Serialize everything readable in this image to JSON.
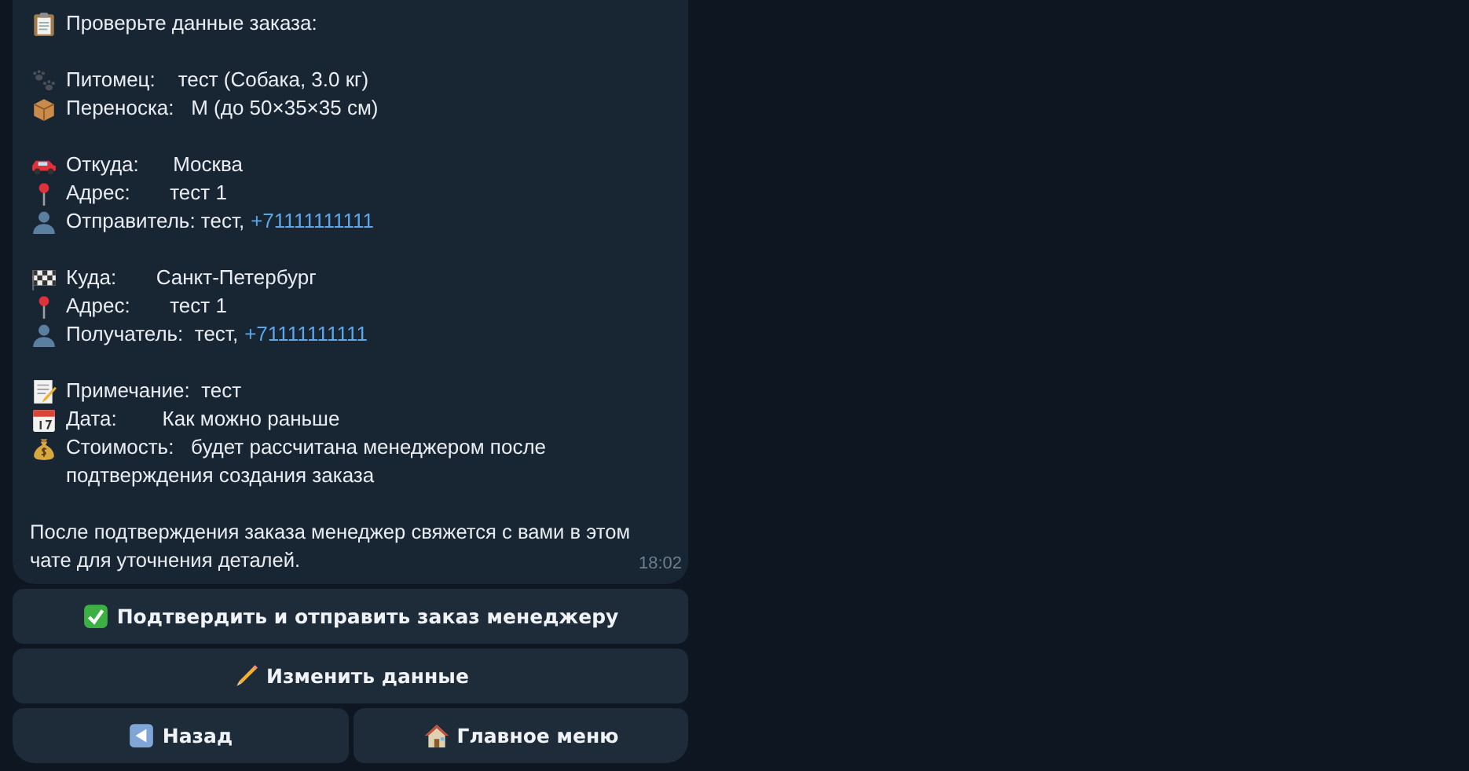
{
  "message": {
    "sections": [
      {
        "lines": [
          {
            "kind": "clipboard",
            "text": "Проверьте данные заказа:"
          }
        ]
      },
      {
        "lines": [
          {
            "kind": "paws",
            "text": "Питомец:    тест (Собака, 3.0 кг)"
          },
          {
            "kind": "box",
            "text": "Переноска:   M (до 50×35×35 см)"
          }
        ]
      },
      {
        "lines": [
          {
            "kind": "car",
            "text": "Откуда:      Москва"
          },
          {
            "kind": "pin",
            "text": "Адрес:       тест 1"
          },
          {
            "kind": "person",
            "text": "Отправитель: тест,",
            "phone": "+71111111111"
          }
        ]
      },
      {
        "lines": [
          {
            "kind": "flag",
            "text": "Куда:       Санкт-Петербург"
          },
          {
            "kind": "pin",
            "text": "Адрес:       тест 1"
          },
          {
            "kind": "person",
            "text": "Получатель:  тест,",
            "phone": "+71111111111"
          }
        ]
      },
      {
        "lines": [
          {
            "kind": "memo",
            "text": "Примечание:  тест"
          },
          {
            "kind": "calendar",
            "text": "Дата:        Как можно раньше"
          },
          {
            "kind": "moneybag",
            "text": "Стоимость:   будет рассчитана менеджером после подтверждения создания заказа"
          }
        ]
      },
      {
        "lines": [
          {
            "text": "После подтверждения заказа менеджер свяжется с вами в этом чате для уточнения деталей."
          }
        ]
      }
    ],
    "time": "18:02"
  },
  "button_rows": [
    [
      {
        "kind": "check",
        "label": "Подтвердить и отправить заказ менеджеру"
      }
    ],
    [
      {
        "kind": "pencil",
        "label": "Изменить данные"
      }
    ],
    [
      {
        "kind": "back",
        "label": "Назад"
      },
      {
        "kind": "house",
        "label": "Главное меню"
      }
    ]
  ]
}
